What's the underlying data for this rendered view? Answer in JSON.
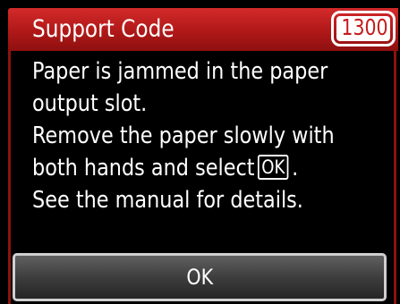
{
  "header": {
    "title": "Support Code",
    "code": "1300",
    "accent_color": "#c41c1c"
  },
  "message": {
    "line1": "Paper is jammed in the paper",
    "line2": "output slot.",
    "line3": "Remove the paper slowly with",
    "line4_before": "both hands and select",
    "line4_key": "OK",
    "line4_after": ".",
    "line5": "See the manual for details."
  },
  "footer": {
    "ok_label": "OK"
  }
}
